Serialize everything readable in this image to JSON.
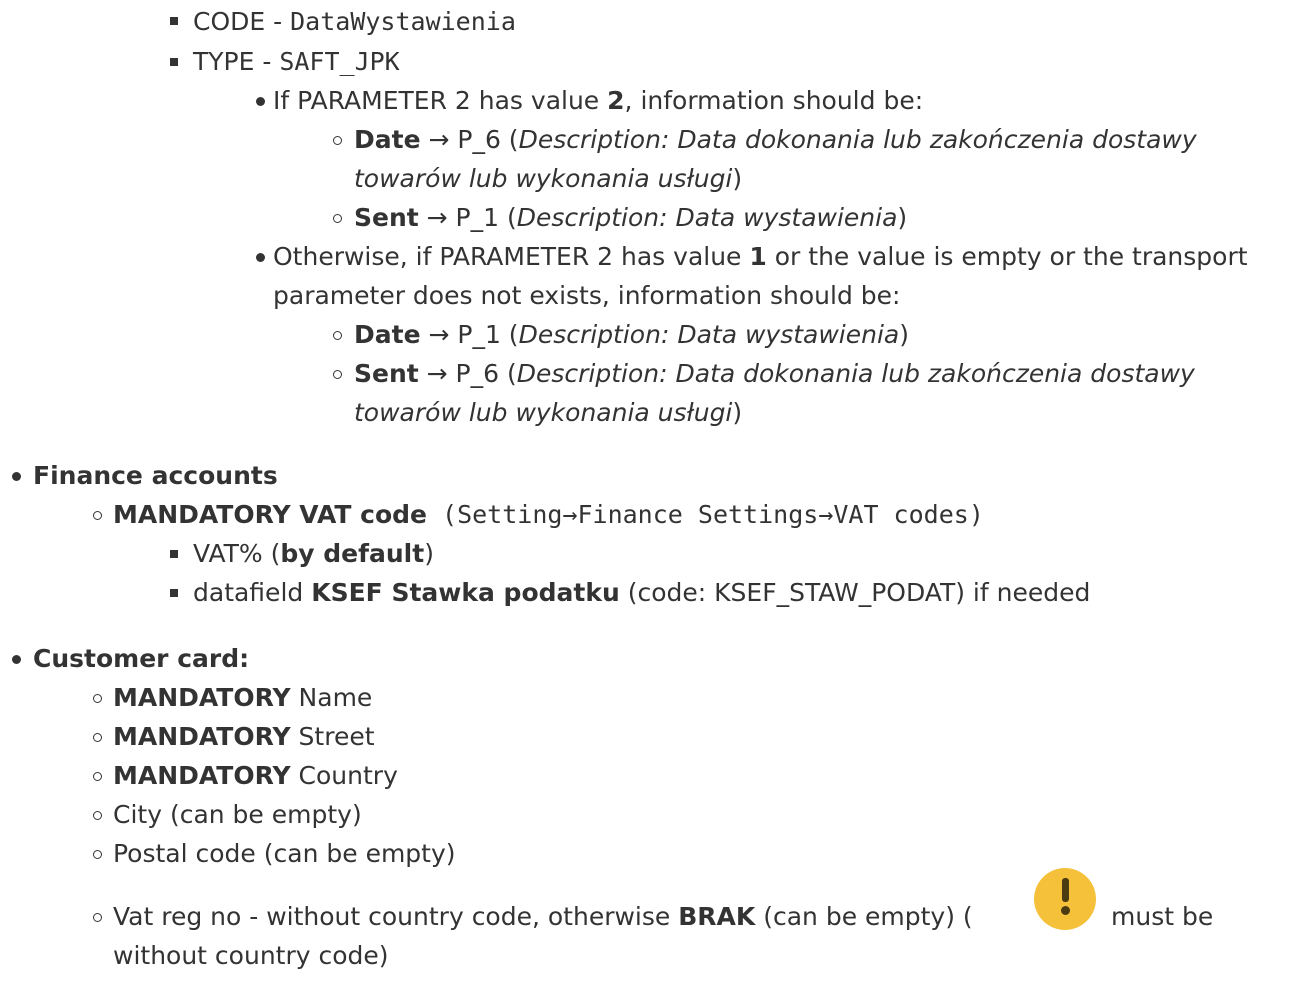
{
  "list": {
    "code_label": "CODE - ",
    "code_value": "DataWystawienia",
    "type_label": "TYPE - ",
    "type_value": "SAFT_JPK",
    "if_param_prefix": "If PARAMETER  2 has value ",
    "if_param_value": "2",
    "if_param_suffix": ", information should be:",
    "p2_date": {
      "label": "Date",
      "arrow": " → P_6 (",
      "desc": "Description: Data dokonania lub zakończenia dostawy",
      "desc2": "towarów lub wykonania usługi",
      "close": ")"
    },
    "p2_sent": {
      "label": "Sent",
      "arrow": " → P_1 (",
      "desc": "Description: Data wystawienia",
      "close": ")"
    },
    "otherwise_prefix": "Otherwise, if PARAMETER  2 has value ",
    "otherwise_value": "1",
    "otherwise_suffix": " or the value is empty or the transport",
    "otherwise_line2": "parameter does not exists, information should be:",
    "p1_date": {
      "label": "Date",
      "arrow": " → P_1 (",
      "desc": "Description: Data wystawienia",
      "close": ")"
    },
    "p1_sent": {
      "label": "Sent",
      "arrow": " → P_6 (",
      "desc": "Description: Data dokonania lub zakończenia dostawy",
      "desc2": "towarów lub wykonania usługi",
      "close": ")"
    }
  },
  "finance": {
    "heading": "Finance accounts",
    "vat_label": "MANDATORY VAT code",
    "vat_path": " (Setting→Finance Settings→VAT codes)",
    "vat_pct": "VAT% (",
    "vat_default": "by default",
    "vat_close": ")",
    "datafield_prefix": "datafield ",
    "datafield_name": "KSEF Stawka podatku",
    "datafield_suffix": " (code: KSEF_STAW_PODAT) if needed"
  },
  "customer": {
    "heading": "Customer card:",
    "mandatory_label": "MANDATORY",
    "name": " Name",
    "street": " Street",
    "country": " Country",
    "city": "City (can be empty)",
    "postal": "Postal code (can be empty)",
    "vat_prefix": "Vat reg no - without country code, otherwise ",
    "vat_brak": "BRAK",
    "vat_mid": " (can be empty) (",
    "vat_note": "must be",
    "vat_note2": "without country code)",
    "warning_icon": "exclamation-icon",
    "warning_color": "#f5c13a"
  }
}
